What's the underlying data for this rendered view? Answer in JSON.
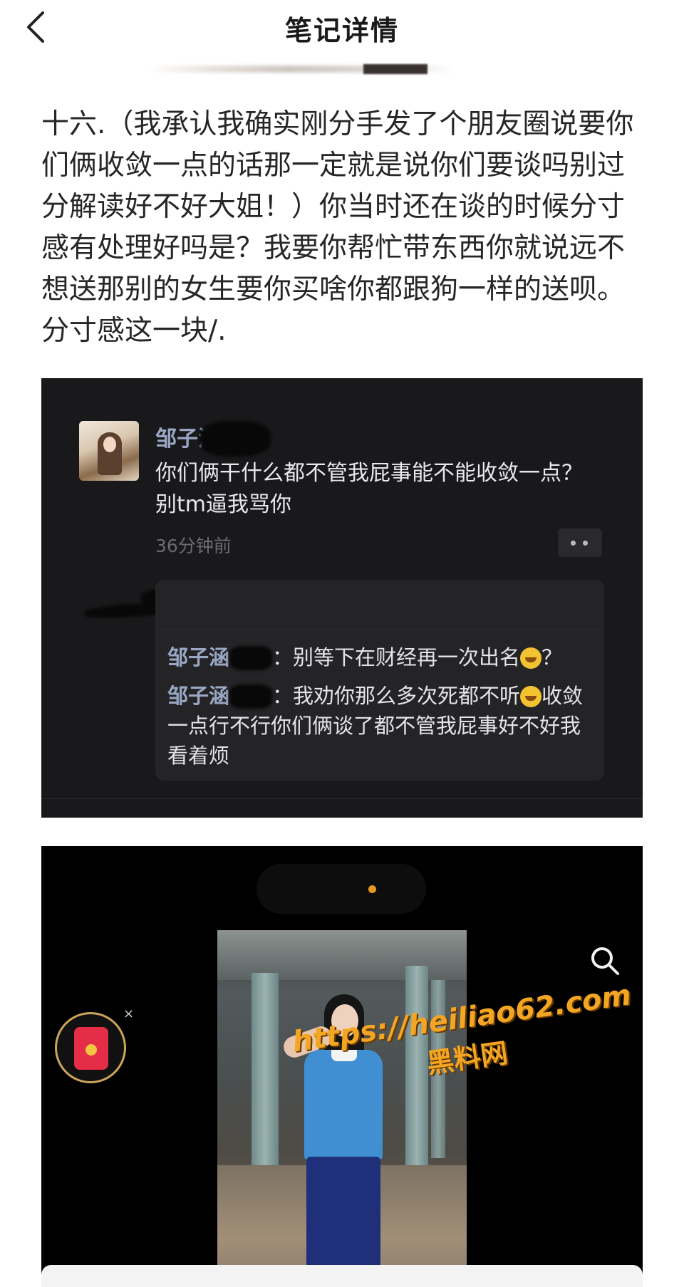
{
  "nav": {
    "title": "笔记详情",
    "back_icon": "chevron-left-icon"
  },
  "post": {
    "text": "十六.（我承认我确实刚分手发了个朋友圈说要你们俩收敛一点的话那一定就是说你们要谈吗别过分解读好不好大姐！）你当时还在谈的时候分寸感有处理好吗是？我要你帮忙带东西你就说远不想送那别的女生要你买啥你都跟狗一样的送呗。分寸感这一块/."
  },
  "comment_shot": {
    "name": "邹子涵",
    "text": "你们俩干什么都不管我屁事能不能收敛一点？别tm逼我骂你",
    "time": "36分钟前",
    "replies": [
      {
        "name": "邹子涵",
        "sep": "：",
        "text_before": "别等下在财经再一次出名",
        "text_after": "？"
      },
      {
        "name": "邹子涵",
        "sep": "：",
        "text_before": "我劝你那么多次死都不听",
        "text_after": "收敛一点行不行你们俩谈了都不管我屁事好不好我看着烦"
      }
    ]
  },
  "video_shot": {
    "close_mark": "×",
    "search_icon": "search-icon",
    "redpacket_icon": "red-packet-icon"
  },
  "watermark": {
    "url": "https://heiliao62.com",
    "name": "黑料网"
  },
  "colors": {
    "accent_name": "#9aa7c4",
    "dark_bg": "#19191b",
    "watermark": "#f3a623"
  }
}
